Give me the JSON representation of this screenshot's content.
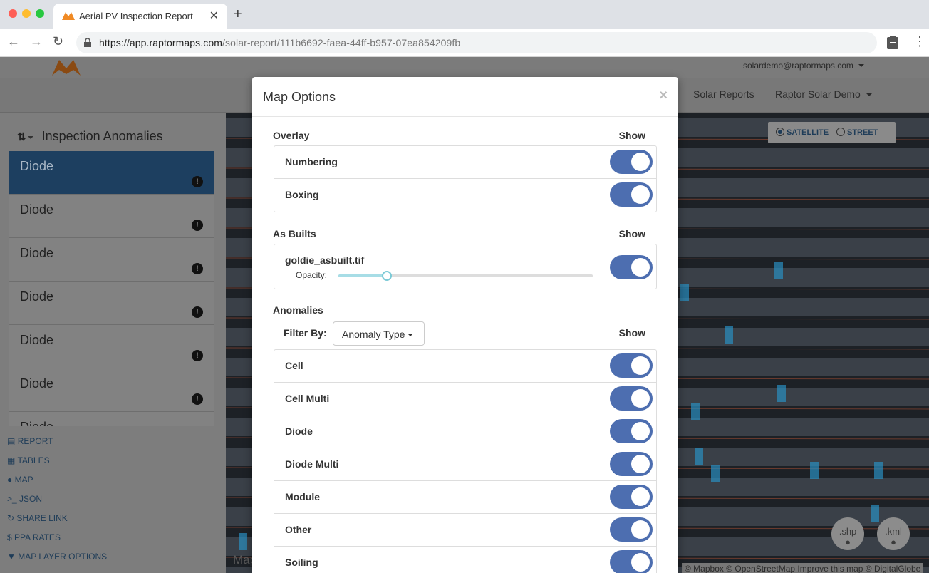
{
  "browser": {
    "tab_title": "Aerial PV Inspection Report",
    "tab_close": "✕",
    "new_tab": "+",
    "url_host": "https://app.raptormaps.com",
    "url_path": "/solar-report/111b6692-faea-44ff-b957-07ea854209fb"
  },
  "header": {
    "user_email": "solardemo@raptormaps.com",
    "nav": [
      "Solar Reports",
      "Raptor Solar Demo"
    ]
  },
  "sidebar": {
    "title": "Inspection Anomalies",
    "items": [
      {
        "label": "Diode",
        "active": true
      },
      {
        "label": "Diode"
      },
      {
        "label": "Diode"
      },
      {
        "label": "Diode"
      },
      {
        "label": "Diode"
      },
      {
        "label": "Diode"
      },
      {
        "label": "Diode"
      }
    ],
    "links": [
      "REPORT",
      "TABLES",
      "MAP",
      "JSON",
      "SHARE LINK",
      "PPA RATES",
      "MAP LAYER OPTIONS"
    ],
    "link_icons": [
      "▤",
      "▦",
      "●",
      ">_",
      "↻",
      "$",
      "▼"
    ]
  },
  "map": {
    "basemap_options": [
      "SATELLITE",
      "STREET"
    ],
    "selected_basemap": "SATELLITE",
    "download_buttons": [
      ".shp",
      ".kml"
    ],
    "attribution": "© Mapbox © OpenStreetMap Improve this map © DigitalGlobe",
    "logo_text": "Map"
  },
  "modal": {
    "title": "Map Options",
    "close": "×",
    "show_header": "Show",
    "overlay": {
      "title": "Overlay",
      "rows": [
        {
          "label": "Numbering",
          "on": true
        },
        {
          "label": "Boxing",
          "on": true
        }
      ]
    },
    "as_builts": {
      "title": "As Builts",
      "file": "goldie_asbuilt.tif",
      "opacity_label": "Opacity:",
      "opacity_value": 0.19,
      "on": true
    },
    "anomalies": {
      "title": "Anomalies",
      "filter_label": "Filter By:",
      "filter_value": "Anomaly Type",
      "rows": [
        {
          "label": "Cell",
          "on": true
        },
        {
          "label": "Cell Multi",
          "on": true
        },
        {
          "label": "Diode",
          "on": true
        },
        {
          "label": "Diode Multi",
          "on": true
        },
        {
          "label": "Module",
          "on": true
        },
        {
          "label": "Other",
          "on": true
        },
        {
          "label": "Soiling",
          "on": true
        }
      ]
    }
  },
  "colors": {
    "toggle_on": "#4d6eb0",
    "active_item": "#1d3f60",
    "anomaly_marker": "#2a8fc1"
  }
}
